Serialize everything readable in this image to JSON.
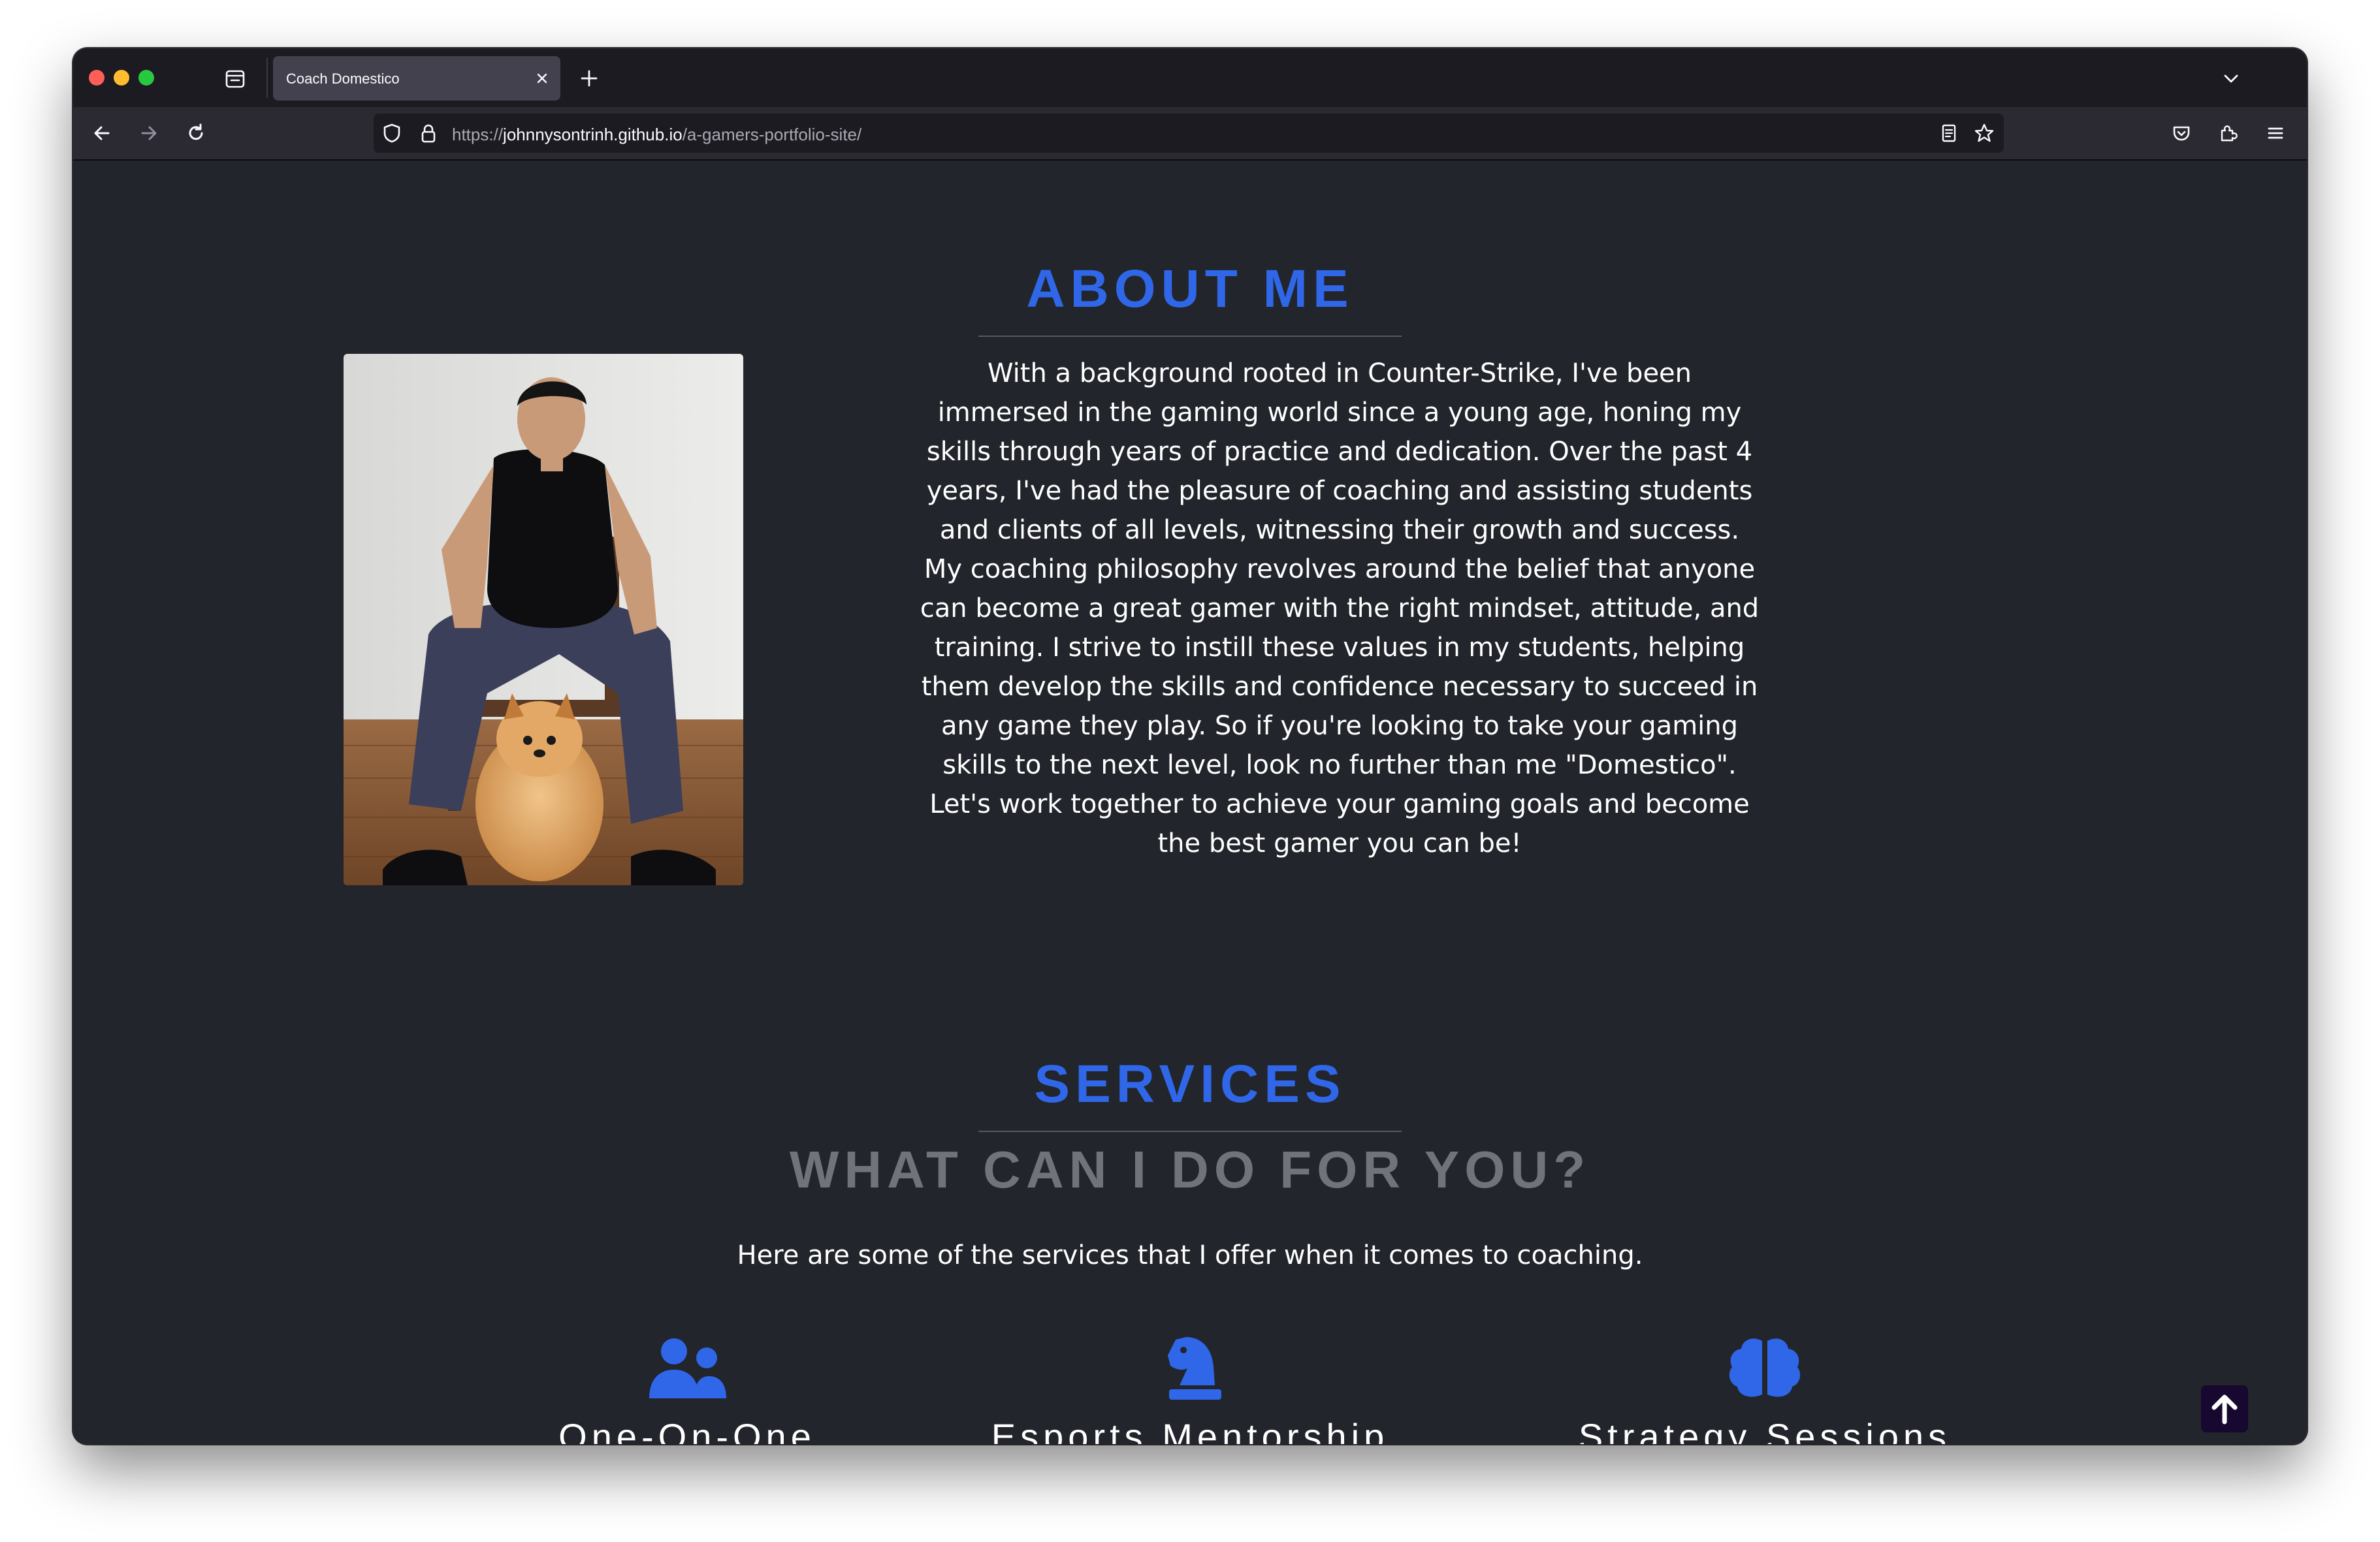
{
  "browser": {
    "tab_title": "Coach Domestico",
    "url_prefix": "https://",
    "url_host": "johnnysontrinh.github.io",
    "url_path": "/a-gamers-portfolio-site/"
  },
  "about": {
    "title": "ABOUT ME",
    "text": "With a background rooted in Counter-Strike, I've been immersed in the gaming world since a young age, honing my skills through years of practice and dedication. Over the past 4 years, I've had the pleasure of coaching and assisting students and clients of all levels, witnessing their growth and success. My coaching philosophy revolves around the belief that anyone can become a great gamer with the right mindset, attitude, and training. I strive to instill these values in my students, helping them develop the skills and confidence necessary to succeed in any game they play. So if you're looking to take your gaming skills to the next level, look no further than me \"Domestico\". Let's work together to achieve your gaming goals and become the best gamer you can be!"
  },
  "services": {
    "title": "SERVICES",
    "subtitle": "WHAT CAN I DO FOR YOU?",
    "description": "Here are some of the services that I offer when it comes to coaching.",
    "items": [
      {
        "label": "One-On-One",
        "icon": "users-icon"
      },
      {
        "label": "Esports Mentorship",
        "icon": "chess-knight-icon"
      },
      {
        "label": "Strategy Sessions",
        "icon": "brain-icon"
      }
    ]
  },
  "colors": {
    "accent": "#2f67e8",
    "background": "#22252b",
    "subtitle": "#70737a",
    "back_to_top_bg": "#16082e"
  }
}
